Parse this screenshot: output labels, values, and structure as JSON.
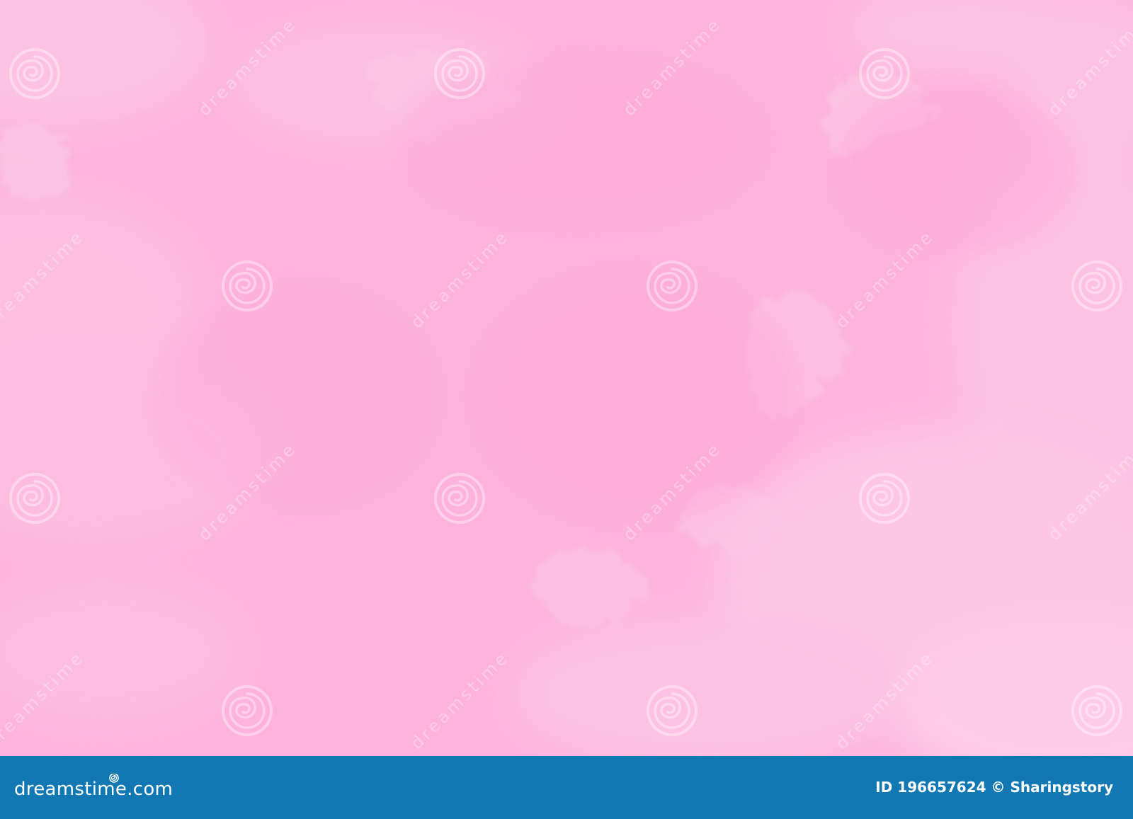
{
  "photo": {
    "subject": "pink sky with soft white clouds",
    "colors": {
      "base": "#fdb3dc",
      "cloud": "#fdc8e6",
      "cloud_light": "#ffd2ea"
    },
    "watermark": {
      "text": "dreamstime",
      "icon": "spiral-logo-icon",
      "color": "#ffffff"
    }
  },
  "footer": {
    "background": "#1278b3",
    "brand": {
      "text": "dreamstime.com",
      "icon": "spiral-logo-icon"
    },
    "credit": {
      "id_label": "ID",
      "id_value": "196657624",
      "copyright_symbol": "©",
      "author": "Sharingstory"
    }
  }
}
